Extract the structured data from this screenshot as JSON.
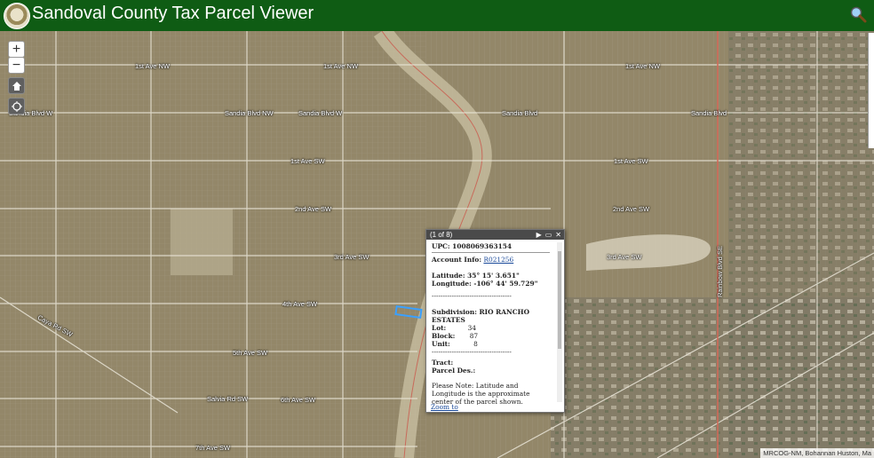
{
  "header": {
    "title": "Sandoval County Tax Parcel Viewer"
  },
  "map_controls": {
    "zoom_in": "+",
    "zoom_out": "−"
  },
  "road_labels": [
    {
      "text": "1st Ave NW"
    },
    {
      "text": "1st Ave NW"
    },
    {
      "text": "1st Ave NW"
    },
    {
      "text": "Sandia Blvd W"
    },
    {
      "text": "Sandia Blvd NW"
    },
    {
      "text": "Sandia Blvd W"
    },
    {
      "text": "Sandia Blvd"
    },
    {
      "text": "Sandia Blvd"
    },
    {
      "text": "1st Ave SW"
    },
    {
      "text": "1st Ave SW"
    },
    {
      "text": "2nd Ave SW"
    },
    {
      "text": "2nd Ave SW"
    },
    {
      "text": "3rd Ave SW"
    },
    {
      "text": "3rd Ave SW"
    },
    {
      "text": "4th Ave SW"
    },
    {
      "text": "5th Ave SW"
    },
    {
      "text": "6th Ave SW"
    },
    {
      "text": "7th Ave SW"
    },
    {
      "text": "Caya Rd SW"
    },
    {
      "text": "Salvia Rd SW"
    },
    {
      "text": "Rainbow Blvd SE"
    }
  ],
  "popup": {
    "counter": "(1 of 8)",
    "upc": "UPC: 1008069363154",
    "account_label": "Account Info:",
    "account_value": "R021256",
    "latitude": "Latitude: 35° 15' 3.651\"",
    "longitude": "Longitude: -106° 44' 59.729\"",
    "divider": "------------------------------------",
    "subdivision": "Subdivision: RIO RANCHO ESTATES",
    "lot_label": "Lot:",
    "lot_value": "34",
    "block_label": "Block:",
    "block_value": "87",
    "unit_label": "Unit:",
    "unit_value": "8",
    "divider2": "------------------------------------",
    "tract": "Tract:",
    "parcel_des": "Parcel Des.:",
    "note": "Please Note: Latitude and Longitude is the approximate center of the parcel shown.",
    "zoom_to": "Zoom to"
  },
  "attribution": "MRCOG-NM, Bohannan Huston, Ma"
}
